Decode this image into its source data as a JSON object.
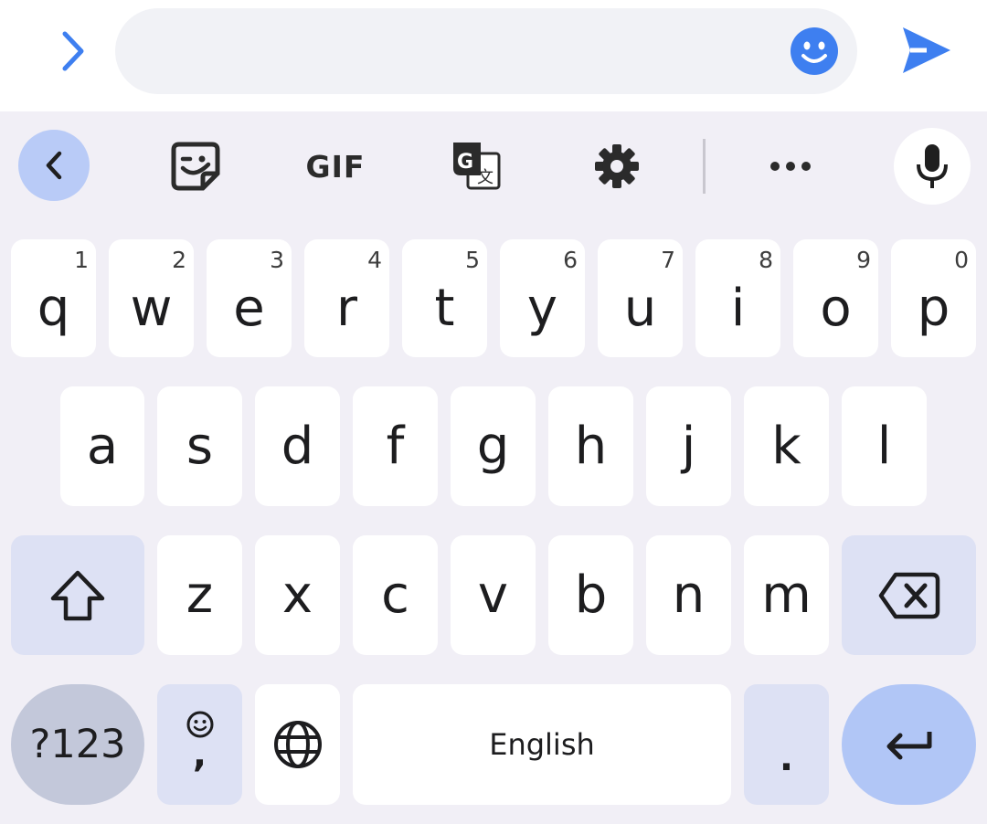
{
  "compose": {
    "placeholder": "",
    "icons": {
      "expand": "chevron-right-icon",
      "emoji": "smiley-icon",
      "send": "send-icon"
    },
    "accent_color": "#3e7ff0"
  },
  "toolbar": {
    "items": [
      "chevron-left-icon",
      "sticker-icon",
      "GIF",
      "translate-icon",
      "gear-icon",
      "more-icon",
      "microphone-icon"
    ],
    "gif_label": "GIF"
  },
  "keyboard": {
    "row1": [
      {
        "letter": "q",
        "hint": "1"
      },
      {
        "letter": "w",
        "hint": "2"
      },
      {
        "letter": "e",
        "hint": "3"
      },
      {
        "letter": "r",
        "hint": "4"
      },
      {
        "letter": "t",
        "hint": "5"
      },
      {
        "letter": "y",
        "hint": "6"
      },
      {
        "letter": "u",
        "hint": "7"
      },
      {
        "letter": "i",
        "hint": "8"
      },
      {
        "letter": "o",
        "hint": "9"
      },
      {
        "letter": "p",
        "hint": "0"
      }
    ],
    "row2": [
      "a",
      "s",
      "d",
      "f",
      "g",
      "h",
      "j",
      "k",
      "l"
    ],
    "row3": [
      "z",
      "x",
      "c",
      "v",
      "b",
      "n",
      "m"
    ],
    "symbols_label": "?123",
    "comma_label": ",",
    "space_label": "English",
    "period_label": ".",
    "colors": {
      "key": "#ffffff",
      "function_key": "#dde1f4",
      "enter": "#b1c6f6",
      "symbols": "#c3c8da",
      "background": "#f1eff6"
    }
  }
}
